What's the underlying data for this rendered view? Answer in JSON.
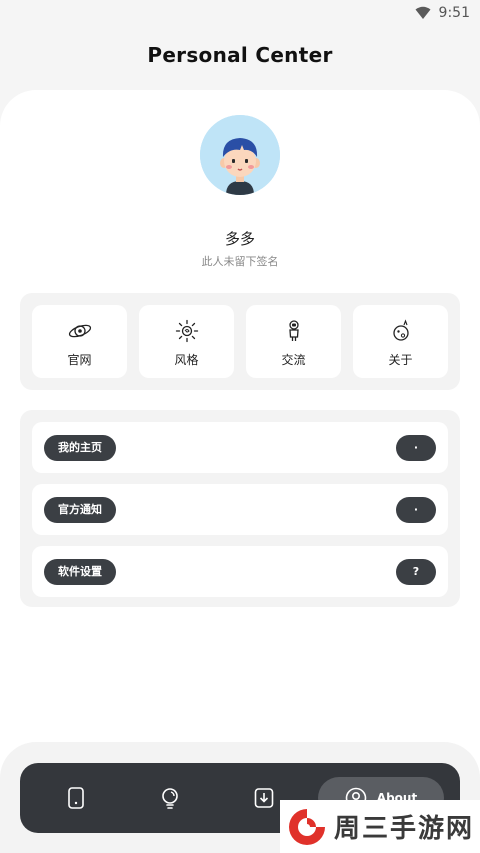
{
  "status_bar": {
    "time": "9:51"
  },
  "header": {
    "title": "Personal Center"
  },
  "profile": {
    "name": "多多",
    "signature": "此人未留下签名"
  },
  "quick_actions": [
    {
      "label": "官网",
      "icon": "planet-icon"
    },
    {
      "label": "风格",
      "icon": "sun-icon"
    },
    {
      "label": "交流",
      "icon": "astronaut-icon"
    },
    {
      "label": "关于",
      "icon": "moon-icon"
    }
  ],
  "menu": [
    {
      "label": "我的主页",
      "badge": "·"
    },
    {
      "label": "官方通知",
      "badge": "·"
    },
    {
      "label": "软件设置",
      "badge": "?"
    }
  ],
  "tab_bar": {
    "tabs": [
      {
        "icon": "phone-icon"
      },
      {
        "icon": "bulb-icon"
      },
      {
        "icon": "download-icon"
      },
      {
        "icon": "user-icon",
        "label": "About"
      }
    ],
    "active_index": 3
  },
  "watermark": {
    "text": "周三手游网"
  },
  "colors": {
    "accent_dark": "#3b3f44",
    "tab_bar_bg": "#34373c",
    "avatar_bg": "#bfe4f7",
    "watermark_red": "#e0312a"
  }
}
